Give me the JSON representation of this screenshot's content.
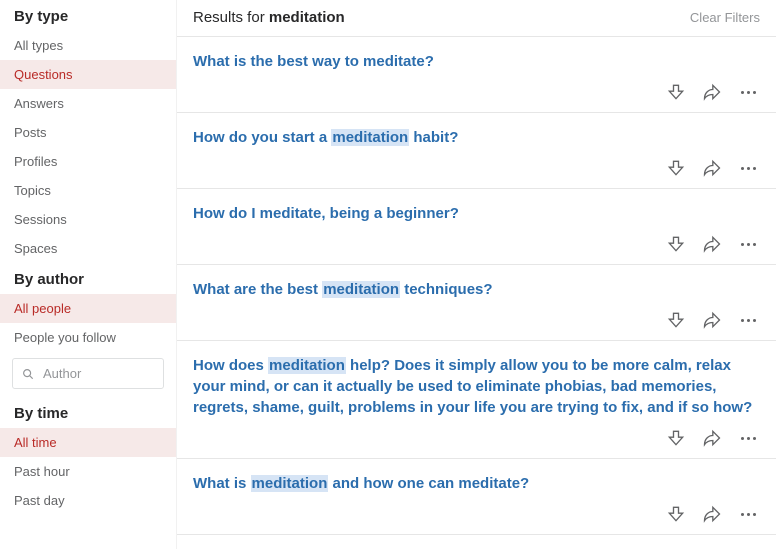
{
  "sidebar": {
    "sections": [
      {
        "heading": "By type",
        "items": [
          {
            "label": "All types",
            "active": false
          },
          {
            "label": "Questions",
            "active": true
          },
          {
            "label": "Answers",
            "active": false
          },
          {
            "label": "Posts",
            "active": false
          },
          {
            "label": "Profiles",
            "active": false
          },
          {
            "label": "Topics",
            "active": false
          },
          {
            "label": "Sessions",
            "active": false
          },
          {
            "label": "Spaces",
            "active": false
          }
        ]
      },
      {
        "heading": "By author",
        "items": [
          {
            "label": "All people",
            "active": true
          },
          {
            "label": "People you follow",
            "active": false
          }
        ],
        "input_placeholder": "Author"
      },
      {
        "heading": "By time",
        "items": [
          {
            "label": "All time",
            "active": true
          },
          {
            "label": "Past hour",
            "active": false
          },
          {
            "label": "Past day",
            "active": false
          }
        ]
      }
    ]
  },
  "header": {
    "prefix": "Results for ",
    "query": "meditation",
    "clear": "Clear Filters"
  },
  "results": [
    {
      "segments": [
        {
          "t": "What is the best way to meditate?",
          "hl": false
        }
      ]
    },
    {
      "segments": [
        {
          "t": "How do you start a ",
          "hl": false
        },
        {
          "t": "meditation",
          "hl": true
        },
        {
          "t": " habit?",
          "hl": false
        }
      ]
    },
    {
      "segments": [
        {
          "t": "How do I meditate, being a beginner?",
          "hl": false
        }
      ]
    },
    {
      "segments": [
        {
          "t": "What are the best ",
          "hl": false
        },
        {
          "t": "meditation",
          "hl": true
        },
        {
          "t": " techniques?",
          "hl": false
        }
      ]
    },
    {
      "segments": [
        {
          "t": "How does ",
          "hl": false
        },
        {
          "t": "meditation",
          "hl": true
        },
        {
          "t": " help? Does it simply allow you to be more calm, relax your mind, or can it actually be used to eliminate phobias, bad memories, regrets, shame, guilt, problems in your life you are trying to fix, and if so how?",
          "hl": false
        }
      ]
    },
    {
      "segments": [
        {
          "t": "What is ",
          "hl": false
        },
        {
          "t": "meditation",
          "hl": true
        },
        {
          "t": " and how one can meditate?",
          "hl": false
        }
      ]
    }
  ]
}
